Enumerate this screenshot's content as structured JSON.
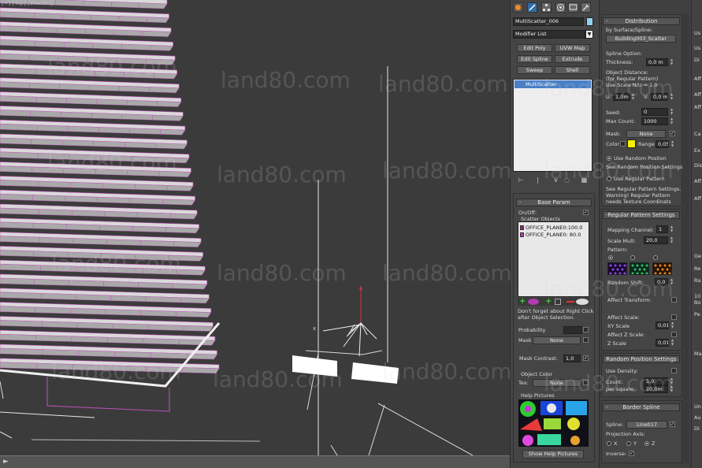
{
  "viewport": {
    "label": "[+] [Top] [Shaded]"
  },
  "watermark": {
    "text": "land80.com"
  },
  "modify": {
    "object_name": "MultiScatter_006",
    "object_color": "#8fd3f0",
    "modifier_list_label": "Modifier List",
    "buttons": [
      "Edit Poly",
      "UVW Map",
      "Edit Spline",
      "Extrude",
      "Sweep",
      "Shell"
    ],
    "stack_item": "MultiScatter"
  },
  "base_param": {
    "title": "Base Param",
    "onoff_label": "On/Off:",
    "scatter_objects_label": "Scatter Objects",
    "objects": [
      "OFFICE_PLANE0:100.0",
      "OFFICE_PLANE0: 80.0"
    ],
    "hint": [
      "Don't forget about Right Click",
      "after Object Selection."
    ],
    "probability_label": "Probability",
    "mask_label": "Mask",
    "mask_value": "None",
    "mask_contrast_label": "Mask Contrast:",
    "mask_contrast_value": "1,0",
    "object_color_label": "Object Color",
    "tex_label": "Tex:",
    "tex_value": "None",
    "help_pictures_label": "Help Pictures",
    "show_help_button": "Show Help Pictures"
  },
  "distribution": {
    "title": "Distribution",
    "by_surface_label": "by Surface/Spline:",
    "surface_button": "Building003_Scatter",
    "spline_option_label": "Spline Option:",
    "thickness_label": "Thickness:",
    "thickness_value": "0,0 m",
    "object_distance": [
      "Object Distance:",
      "(for Regular Pattern)",
      "Use Scale N/U = 1.0"
    ],
    "u_label": "U:",
    "u_value": "1,0m",
    "v_label": "V:",
    "v_value": "0,0 m",
    "seed_label": "Seed:",
    "seed_value": "0",
    "max_count_label": "Max Count:",
    "max_count_value": "1000",
    "mask_label": "Mask:",
    "mask_value": "None",
    "color_label": "Color",
    "color_swatch": "#f2f200",
    "range_label": "Range",
    "range_value": "0,05",
    "use_random_position": "Use Random Positon",
    "see_random_settings": "See Random Position Settings.",
    "use_regular_pattern": "Use Regular Pattern",
    "regular_notes": [
      "See Regular Pattern Settings.",
      "Warning! Regular Pattern",
      "needs Texture Coordinats"
    ]
  },
  "regular_pattern": {
    "title": "Regular Pattern Settings",
    "mapping_channel_label": "Mapping Channel:",
    "mapping_channel_value": "1",
    "scale_mult_label": "Scale Mult:",
    "scale_mult_value": "20,0",
    "pattern_label": "Pattern:",
    "random_shift_label": "Random Shift:",
    "random_shift_value": "0,0",
    "affect_transform_label": "Affect Transform:",
    "affect_scale_label": "Affect Scale:",
    "xy_scale_label": "XY Scale",
    "xy_scale_value": "0,01",
    "affect_z_scale_label": "Affect Z Scale:",
    "z_scale_label": "Z Scale",
    "z_scale_value": "0,01"
  },
  "random_position": {
    "title": "Random Position Settings",
    "use_density_label": "Use Density:",
    "count_label": "Count:",
    "count_value": "1,0",
    "per_square_label": "per square:",
    "per_square_value": "10,0m"
  },
  "border_spline": {
    "title": "Border Spline",
    "spline_label": "Spline:",
    "spline_value": "Line017",
    "projection_axis_label": "Projection Axis:",
    "axes": [
      "X",
      "Y",
      "Z"
    ],
    "inverse_label": "Inverse:"
  },
  "far_right": {
    "labels": [
      "Us",
      "Us",
      "Di",
      "Aff",
      "Aff",
      "Aff",
      "Ca",
      "Ex",
      "Dis",
      "Aff",
      "Aff",
      "Ge",
      "Re",
      "Ra",
      "10",
      "Bo",
      "Pe",
      "Ma",
      "Un",
      "Au",
      "Di"
    ]
  }
}
